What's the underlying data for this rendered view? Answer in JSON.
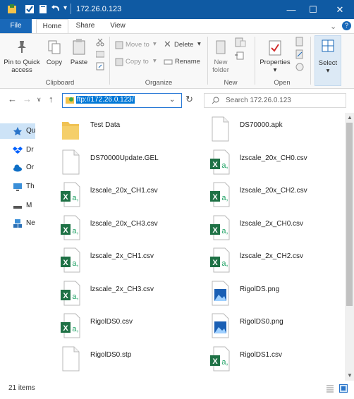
{
  "window": {
    "title": "172.26.0.123",
    "minimize": "—",
    "maximize": "☐",
    "close": "✕"
  },
  "tabs": [
    {
      "label": "File"
    },
    {
      "label": "Home"
    },
    {
      "label": "Share"
    },
    {
      "label": "View"
    }
  ],
  "ribbon": {
    "pin_label_1": "Pin to Quick",
    "pin_label_2": "access",
    "copy": "Copy",
    "paste": "Paste",
    "move_to": "Move to",
    "copy_to": "Copy to",
    "delete": "Delete",
    "rename": "Rename",
    "new_folder_1": "New",
    "new_folder_2": "folder",
    "properties": "Properties",
    "select": "Select",
    "groups": [
      "Clipboard",
      "Organize",
      "New",
      "Open"
    ]
  },
  "address": {
    "value": "ftp://172.26.0.123/",
    "search_placeholder": "Search 172.26.0.123"
  },
  "sidebar": {
    "items": [
      {
        "label": "Qu",
        "icon": "star-icon"
      },
      {
        "label": "Dr",
        "icon": "dropbox-icon"
      },
      {
        "label": "Or",
        "icon": "cloud-icon"
      },
      {
        "label": "Th",
        "icon": "computer-icon"
      },
      {
        "label": "M",
        "icon": "drive-icon"
      },
      {
        "label": "Ne",
        "icon": "network-icon"
      }
    ]
  },
  "files": [
    {
      "name": "Test Data",
      "type": "folder"
    },
    {
      "name": "DS70000.apk",
      "type": "blank"
    },
    {
      "name": "DS70000Update.GEL",
      "type": "blank"
    },
    {
      "name": "lzscale_20x_CH0.csv",
      "type": "excel"
    },
    {
      "name": "lzscale_20x_CH1.csv",
      "type": "excel"
    },
    {
      "name": "lzscale_20x_CH2.csv",
      "type": "excel"
    },
    {
      "name": "lzscale_20x_CH3.csv",
      "type": "excel"
    },
    {
      "name": "lzscale_2x_CH0.csv",
      "type": "excel"
    },
    {
      "name": "lzscale_2x_CH1.csv",
      "type": "excel"
    },
    {
      "name": "lzscale_2x_CH2.csv",
      "type": "excel"
    },
    {
      "name": "lzscale_2x_CH3.csv",
      "type": "excel"
    },
    {
      "name": "RigolDS.png",
      "type": "image"
    },
    {
      "name": "RigolDS0.csv",
      "type": "excel"
    },
    {
      "name": "RigolDS0.png",
      "type": "image"
    },
    {
      "name": "RigolDS0.stp",
      "type": "blank"
    },
    {
      "name": "RigolDS1.csv",
      "type": "excel"
    }
  ],
  "status": {
    "item_count": "21 items"
  },
  "colors": {
    "titlebar": "#0f5aa3",
    "file_tab": "#1968b8",
    "selection": "#0078d7",
    "excel_green": "#1e7145"
  }
}
